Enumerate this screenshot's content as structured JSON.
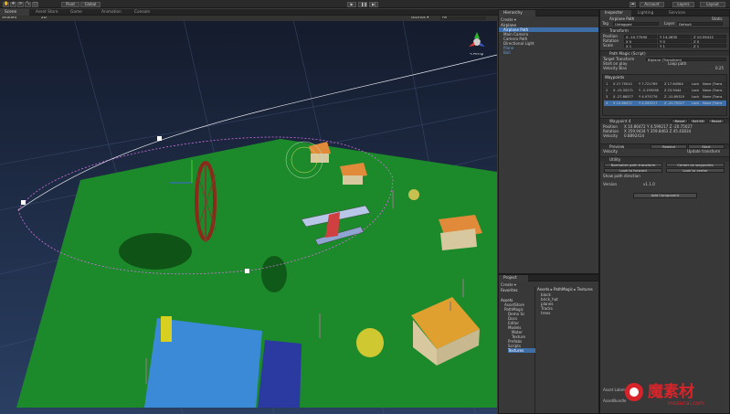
{
  "toolbar": {
    "play": "▶",
    "pause": "❚❚",
    "step": "▶|",
    "pivot": "Pivot",
    "global": "Global",
    "account": "Account",
    "layers": "Layers",
    "layout": "Layout"
  },
  "scene_tabs": {
    "scene": "Scene",
    "asset_store": "Asset Store",
    "game": "Game",
    "animation": "Animation",
    "console": "Console"
  },
  "scene_bar": {
    "shaded": "Shaded",
    "twod": "2D",
    "gizmos": "Gizmos ▾",
    "search": "All",
    "persp": "<Persp"
  },
  "hierarchy": {
    "title": "Hierarchy",
    "create": "Create ▾",
    "scene": "Airplane",
    "items": [
      "Airplane Path",
      "Main Camera",
      "Camera Path",
      "Directional Light",
      "Plane",
      "Ball"
    ]
  },
  "inspector": {
    "tabs": [
      "Inspector",
      "Lighting",
      "Services"
    ],
    "object_name": "Airplane Path",
    "static": "Static",
    "tag_label": "Tag",
    "tag_value": "Untagged",
    "layer_label": "Layer",
    "layer_value": "Default",
    "transform": {
      "title": "Transform",
      "position": [
        "X  -10.77090",
        "Y  14.2635",
        "Z  10.59412"
      ],
      "rotation": [
        "X  0",
        "Y  0",
        "Z  0"
      ],
      "scale": [
        "X  1",
        "Y  1",
        "Z  1"
      ],
      "labels": [
        "Position",
        "Rotation",
        "Scale"
      ]
    },
    "pathmagic": {
      "title": "Path Magic (Script)",
      "target_label": "Target Transform",
      "target_value": "Biplane (Transform)",
      "start_label": "Start on play",
      "loop_label": "Loop path",
      "velocity_label": "Velocity Bias",
      "velocity_value": "0.25"
    },
    "waypoints": {
      "title": "Waypoints",
      "rows": [
        [
          "1",
          "X  27.75010",
          "Y  7.721769",
          "Z  17.64584",
          "Lock",
          "None (Trans"
        ],
        [
          "2",
          "X  -15.33271",
          "Y  -3.199298",
          "Z  23.9444",
          "Lock",
          "None (Trans"
        ],
        [
          "3",
          "X  -27.86577",
          "Y  4.975776",
          "Z  -10.89319",
          "Lock",
          "None (Trans"
        ],
        [
          "4",
          "X  10.86472",
          "Y  4.599217",
          "Z  -20.75027",
          "Lock",
          "None (Trans"
        ]
      ]
    },
    "wp4": {
      "title": "Waypoint 4",
      "btns": [
        "Reset",
        "Set 90",
        "Reset"
      ],
      "position": "X  10.86472   Y  4.599217   Z  -20.75027",
      "rotation": "X  359.9434   Y  359.8463   Z  45.43834",
      "velocity": "0.8892414",
      "labels": [
        "Position",
        "Rotation",
        "Velocity"
      ]
    },
    "preview": {
      "title": "Preview",
      "velocity": "Velocity",
      "rewind": "Rewind",
      "start": "Start",
      "update": "Update transform"
    },
    "utility": {
      "title": "Utility",
      "btns": [
        "Normalize path transform",
        "Center on waypoints",
        "Look to forward",
        "Look to center"
      ],
      "show_dir": "Show path direction",
      "version_label": "Version",
      "version_value": "v1.1.0"
    },
    "add_component": "Add Component",
    "asset_labels": "Asset Labels",
    "asset_bundle": "AssetBundle"
  },
  "project": {
    "title": "Project",
    "create": "Create ▾",
    "favorites": "Favorites",
    "assets": "Assets",
    "tree": [
      "AssetStore",
      "PathMagic",
      "Demo Sc",
      "Docs",
      "Editor",
      "Models",
      "Mater",
      "Texture",
      "Prefabs",
      "Scripts",
      "Textures"
    ],
    "breadcrumb": "Assets ▸ PathMagic ▸ Textures",
    "files": [
      "block",
      "brick_hut",
      "planes",
      "Tracks",
      "trees"
    ]
  },
  "watermark": {
    "text": "魔素材",
    "url": "mosucai.com"
  },
  "colors": {
    "accent": "#3d6ea8",
    "grass": "#1c8a2a",
    "sky": "#1a2b47"
  }
}
